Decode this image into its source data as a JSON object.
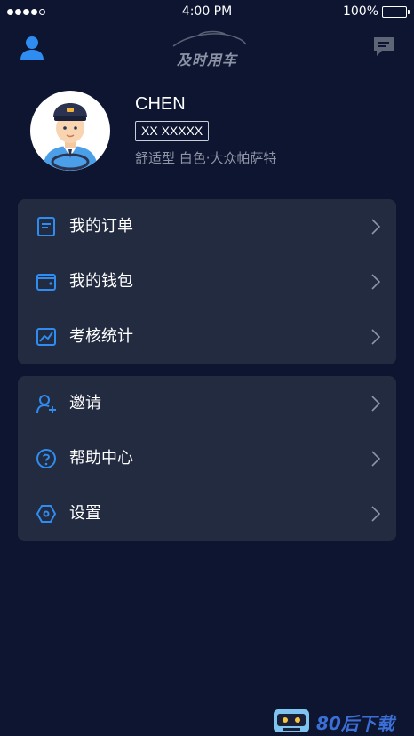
{
  "status_bar": {
    "time": "4:00 PM",
    "battery": "100%",
    "battery_level": 1.0,
    "signal_bars": 4
  },
  "header": {
    "brand": "及时用车",
    "left_icon": "user-icon",
    "right_icon": "message-icon"
  },
  "profile": {
    "name": "CHEN",
    "plate": "XX XXXXX",
    "car_info": "舒适型 白色·大众帕萨特",
    "avatar_icon": "driver-avatar"
  },
  "menu_group_1": [
    {
      "label": "我的订单",
      "icon": "order-icon"
    },
    {
      "label": "我的钱包",
      "icon": "wallet-icon"
    },
    {
      "label": "考核统计",
      "icon": "stats-chart-icon"
    }
  ],
  "menu_group_2": [
    {
      "label": "邀请",
      "icon": "invite-user-icon"
    },
    {
      "label": "帮助中心",
      "icon": "help-icon"
    },
    {
      "label": "设置",
      "icon": "settings-icon"
    }
  ],
  "watermark": {
    "text": "80后下载",
    "icon": "robot-logo"
  },
  "colors": {
    "background": "#0d1530",
    "card": "#232b40",
    "accent": "#2f8cf0",
    "muted_text": "#8f95a6"
  }
}
